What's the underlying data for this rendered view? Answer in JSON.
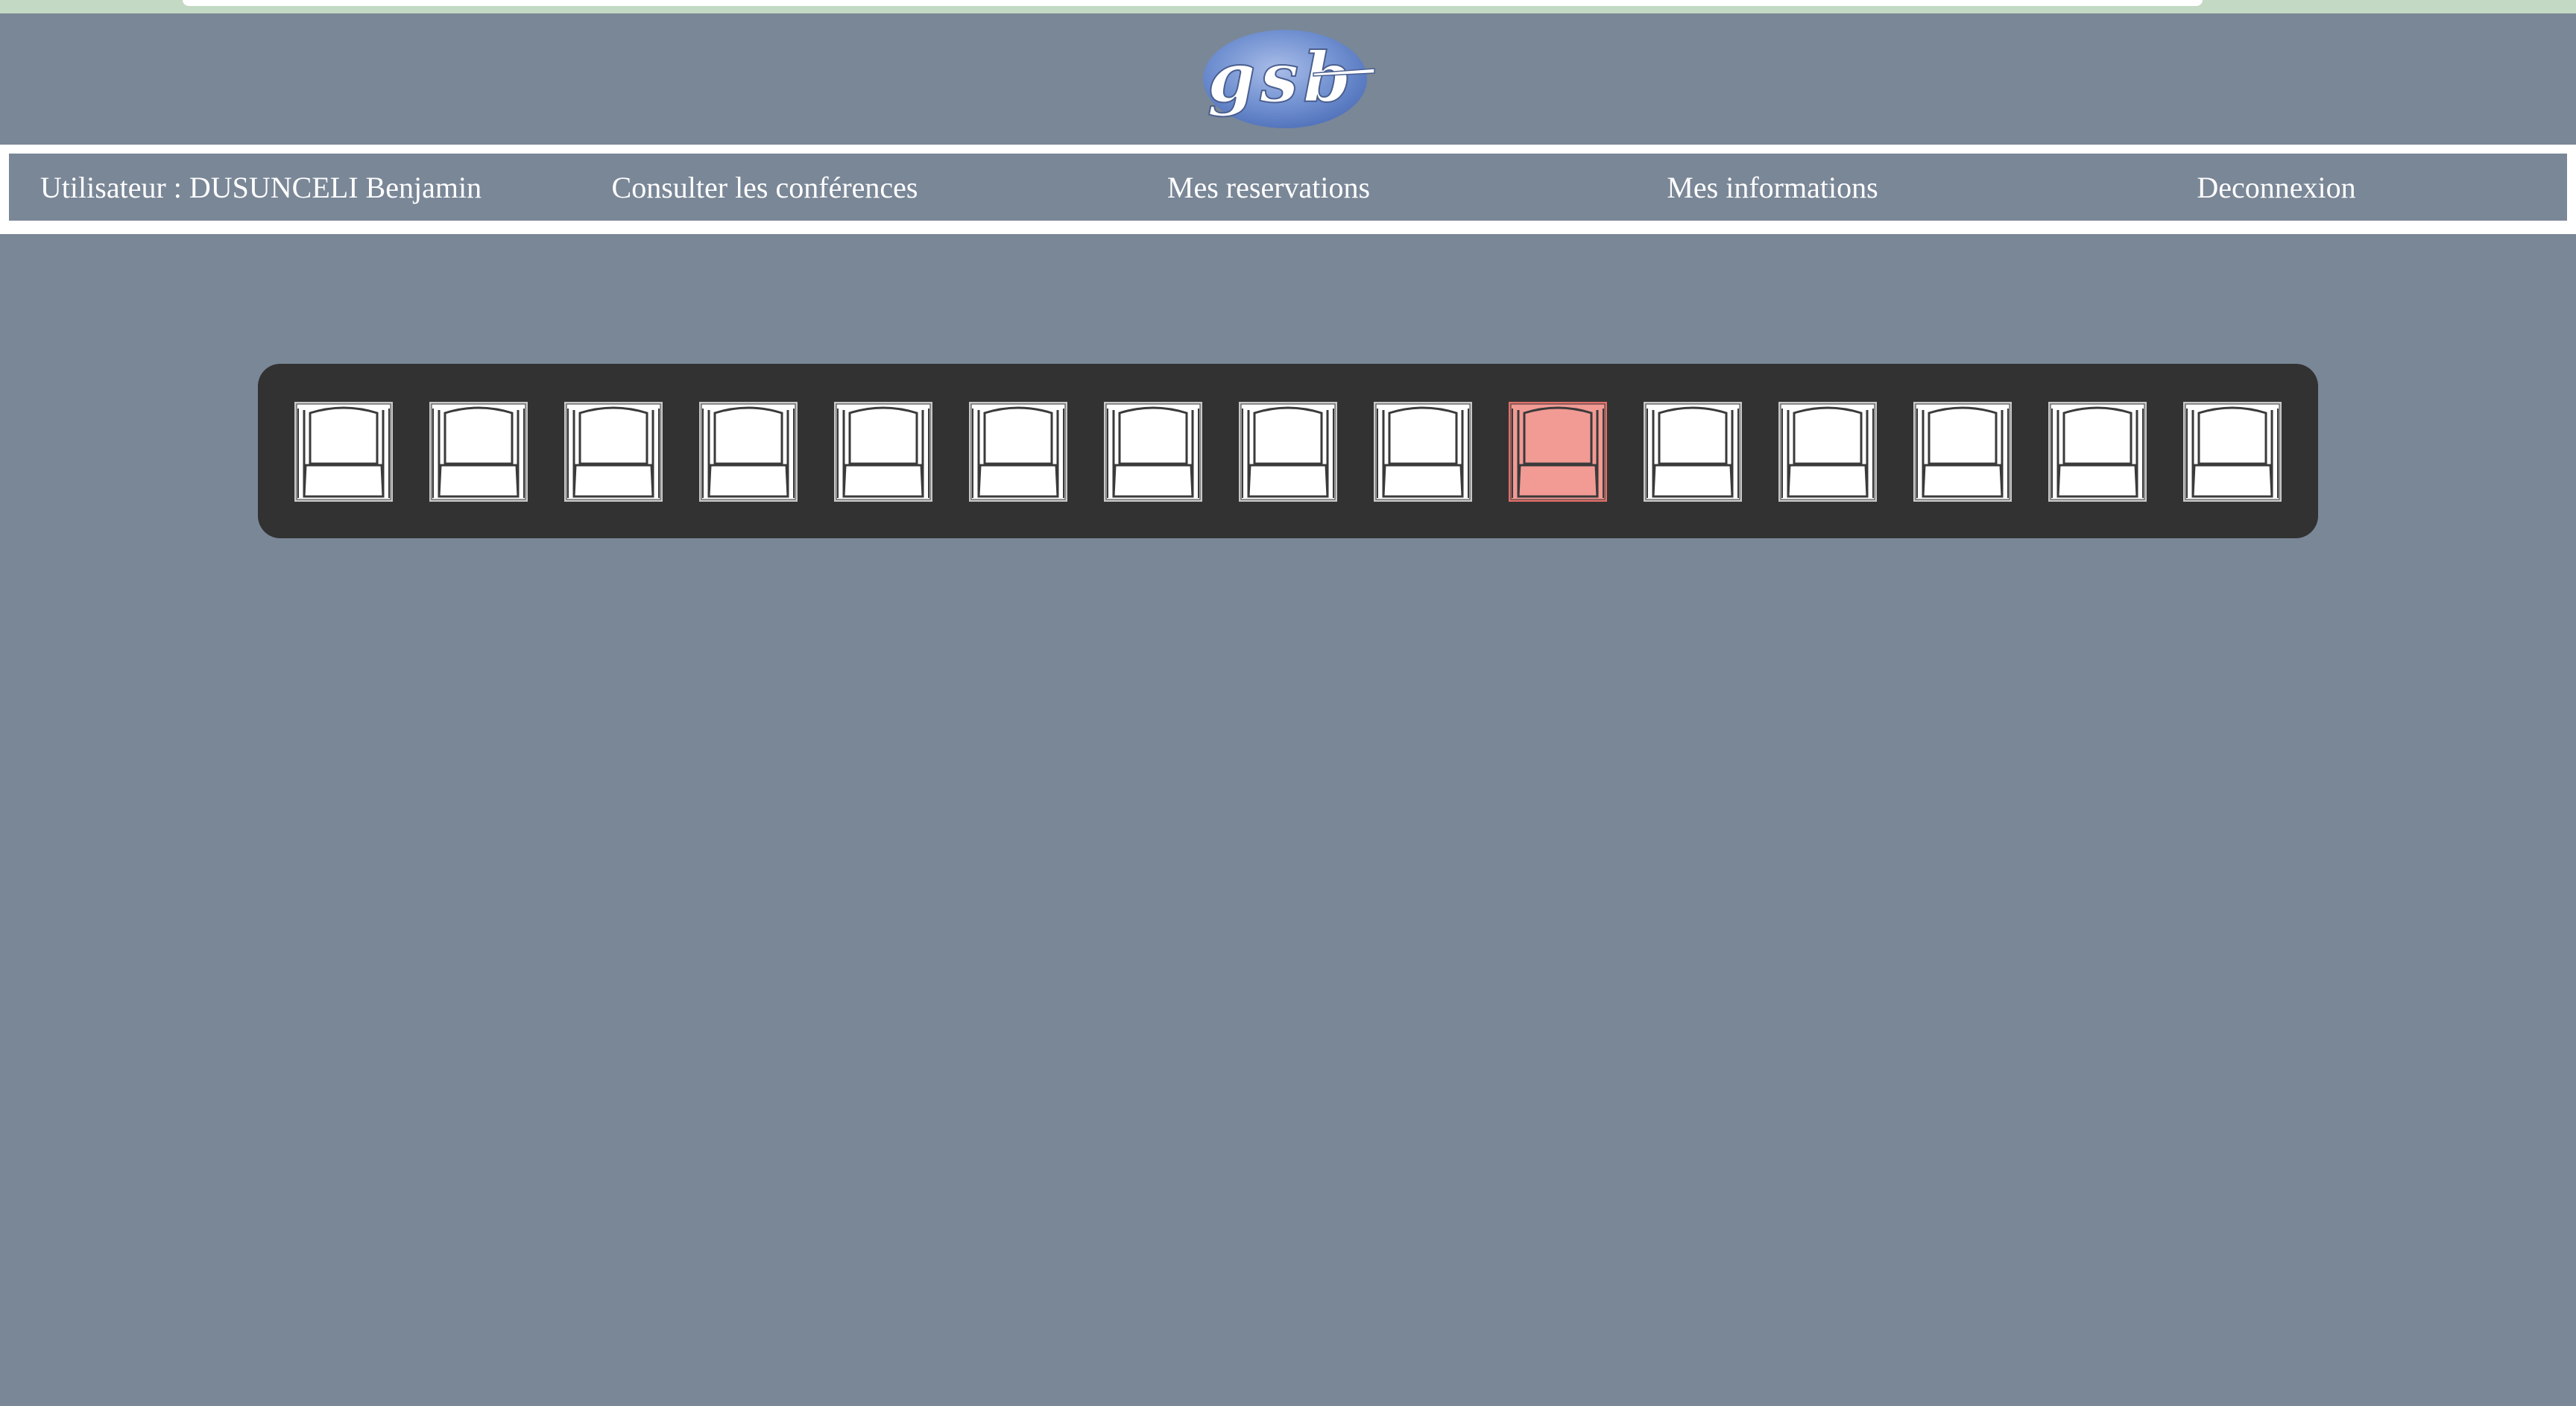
{
  "logo": {
    "text": "gsb"
  },
  "nav": {
    "user_label": "Utilisateur : DUSUNCELI Benjamin",
    "items": [
      {
        "label": "Consulter les conférences"
      },
      {
        "label": "Mes reservations"
      },
      {
        "label": "Mes informations"
      },
      {
        "label": "Deconnexion"
      }
    ]
  },
  "seats": {
    "count": 15,
    "selected_index": 9,
    "colors": {
      "free_fill": "#ffffff",
      "free_frame": "#c8c8c8",
      "selected_fill": "#f29a94",
      "selected_frame": "#e0706a",
      "outline": "#3a3a3a"
    }
  },
  "colors": {
    "page_background": "#7a8797",
    "panel_background": "#323232",
    "nav_border": "#ffffff",
    "top_strip": "#c3d9c3"
  }
}
